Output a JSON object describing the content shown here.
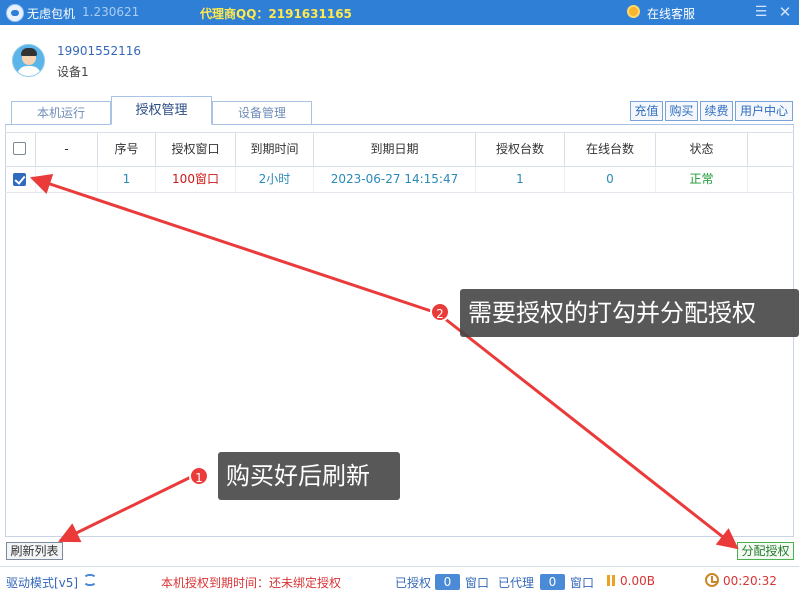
{
  "titlebar": {
    "app_name": "无虑包机",
    "version": "1.230621",
    "agent_qq": "代理商QQ：2191631165",
    "service_label": "在线客服",
    "min_symbol": "☰",
    "close_symbol": "✕"
  },
  "user": {
    "phone": "19901552116",
    "device": "设备1"
  },
  "tabs": [
    {
      "label": "本机运行"
    },
    {
      "label": "授权管理"
    },
    {
      "label": "设备管理"
    }
  ],
  "top_buttons": [
    {
      "label": "充值"
    },
    {
      "label": "购买"
    },
    {
      "label": "续费"
    },
    {
      "label": "用户中心"
    }
  ],
  "table": {
    "headers": [
      "-",
      "序号",
      "授权窗口",
      "到期时间",
      "到期日期",
      "授权台数",
      "在线台数",
      "状态"
    ],
    "rows": [
      {
        "checked": true,
        "dash": "",
        "index": "1",
        "window": "100窗口",
        "duration": "2小时",
        "expire_date": "2023-06-27 14:15:47",
        "auth_count": "1",
        "online_count": "0",
        "status": "正常"
      }
    ]
  },
  "buttons": {
    "refresh": "刷新列表",
    "assign": "分配授权"
  },
  "status": {
    "drive_mode": "驱动模式[v5]",
    "expire_text": "本机授权到期时间：还未绑定授权",
    "authorized_label": "已授权",
    "authorized_count": "0",
    "window_label": "窗口",
    "agent_label": "已代理",
    "agent_count": "0",
    "speed": "0.00B",
    "timer": "00:20:32"
  },
  "annotations": {
    "step1_number": "1",
    "step1_text": "购买好后刷新",
    "step2_number": "2",
    "step2_text": "需要授权的打勾并分配授权",
    "arrow_color": "#ea3a3a"
  }
}
